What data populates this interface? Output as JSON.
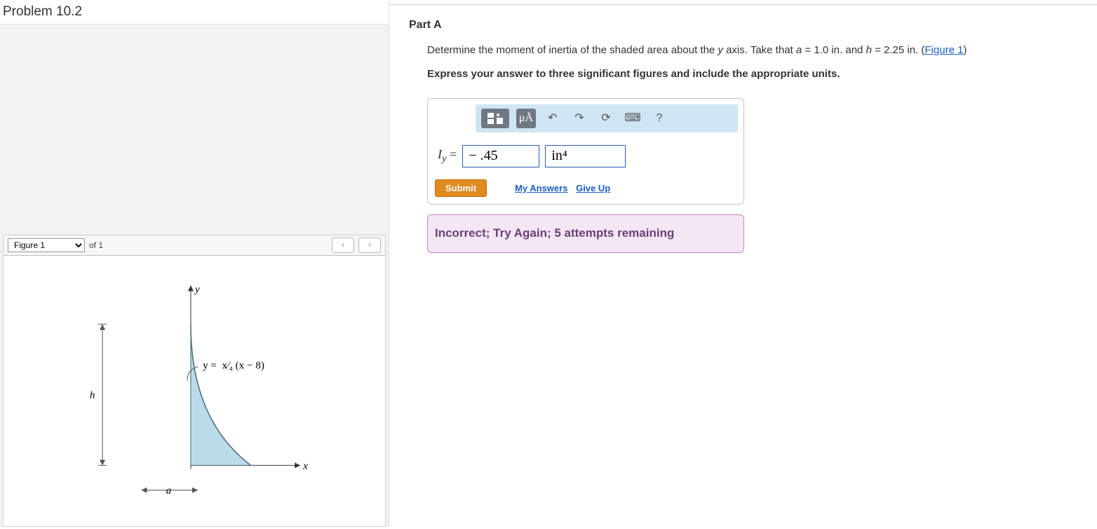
{
  "left": {
    "title": "Problem 10.2",
    "figure": {
      "selector": "Figure 1",
      "of_label": "of 1",
      "prev": "‹",
      "next": "›"
    },
    "diagram": {
      "y_axis": "y",
      "x_axis": "x",
      "h_label": "h",
      "a_label": "a",
      "curve_label": "y =  x⁄₄ (x − 8)"
    }
  },
  "right": {
    "part": "Part A",
    "question_pre": "Determine the moment of inertia of the shaded area about the ",
    "y_var": "y",
    "question_mid": " axis. Take that ",
    "a_var": "a",
    "a_eq": " = 1.0 ",
    "in_unit": "in.",
    "and": " and ",
    "h_var": "h",
    "h_eq": " = 2.25 ",
    "fig_link": "Figure 1",
    "paren_close": ")",
    "paren_open": " (",
    "instruction": "Express your answer to three significant figures and include the appropriate units.",
    "toolbar": {
      "templates": "▢▢",
      "units_label": "μÅ",
      "undo": "↶",
      "redo": "↷",
      "reset": "⟳",
      "keyboard": "⌨",
      "help": "?"
    },
    "answer": {
      "label": "I",
      "label_sub": "y",
      "equals": " = ",
      "value": "− .45",
      "unit": "in⁴"
    },
    "submit": "Submit",
    "my_answers": "My Answers",
    "give_up": "Give Up",
    "feedback": "Incorrect; Try Again; 5 attempts remaining"
  }
}
